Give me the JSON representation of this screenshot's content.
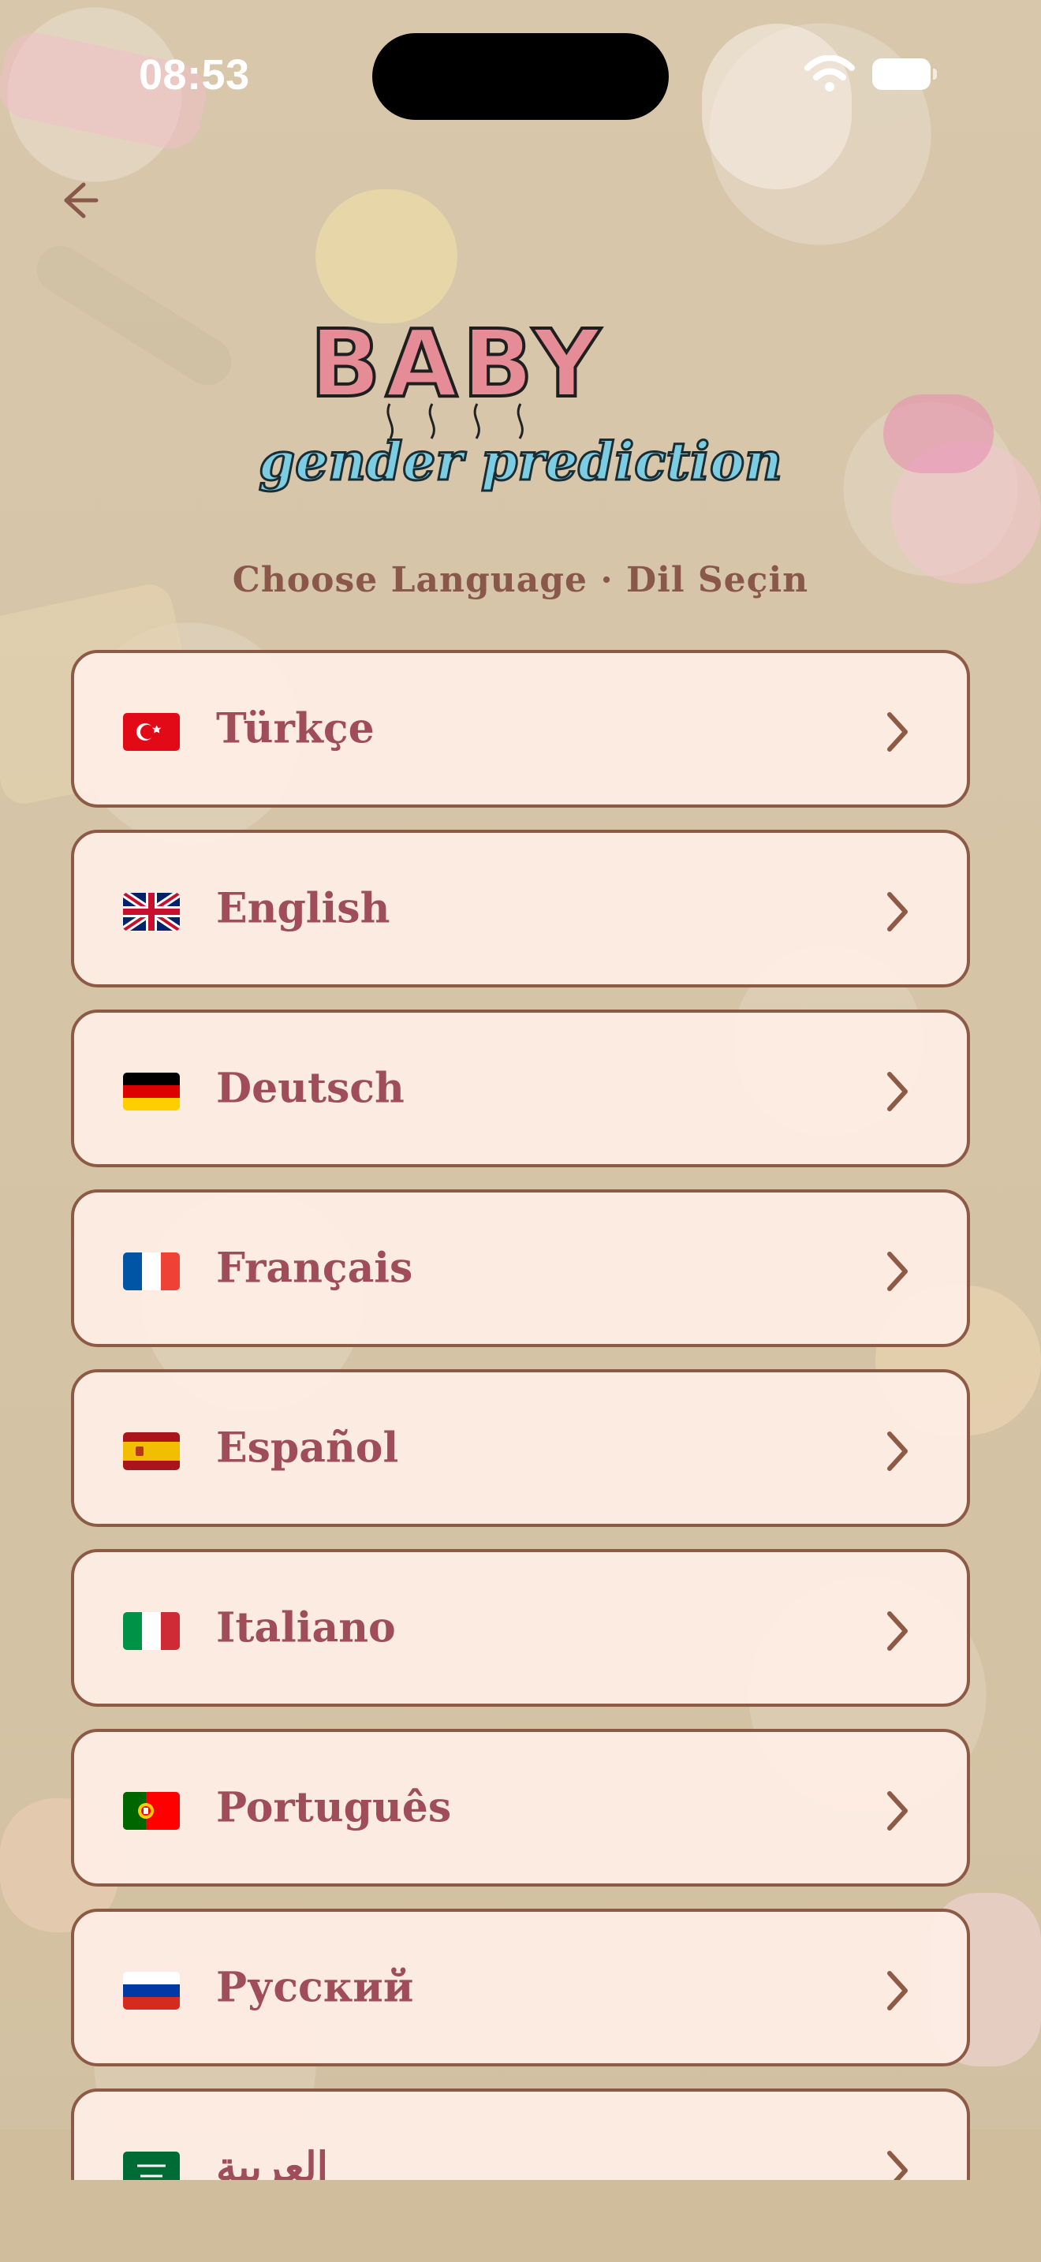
{
  "status_bar": {
    "time": "08:53"
  },
  "header": {
    "back_icon": "arrow-left-icon",
    "logo_text_top": "BABY",
    "logo_text_bottom": "gender prediction",
    "subtitle": "Choose Language · Dil Seçin"
  },
  "languages": [
    {
      "label": "Türkçe",
      "flag_icon": "turkey-flag-icon"
    },
    {
      "label": "English",
      "flag_icon": "uk-flag-icon"
    },
    {
      "label": "Deutsch",
      "flag_icon": "germany-flag-icon"
    },
    {
      "label": "Français",
      "flag_icon": "france-flag-icon"
    },
    {
      "label": "Español",
      "flag_icon": "spain-flag-icon"
    },
    {
      "label": "Italiano",
      "flag_icon": "italy-flag-icon"
    },
    {
      "label": "Português",
      "flag_icon": "portugal-flag-icon"
    },
    {
      "label": "Русский",
      "flag_icon": "russia-flag-icon"
    },
    {
      "label": "العربية",
      "flag_icon": "saudi-arabia-flag-icon"
    }
  ],
  "colors": {
    "card_border": "#8d5a46",
    "card_background": "#ffeee5",
    "label_text": "#9e4d59",
    "subtitle_text": "#8a5848",
    "logo_pink": "#e58c96",
    "logo_blue": "#7ccde2"
  }
}
